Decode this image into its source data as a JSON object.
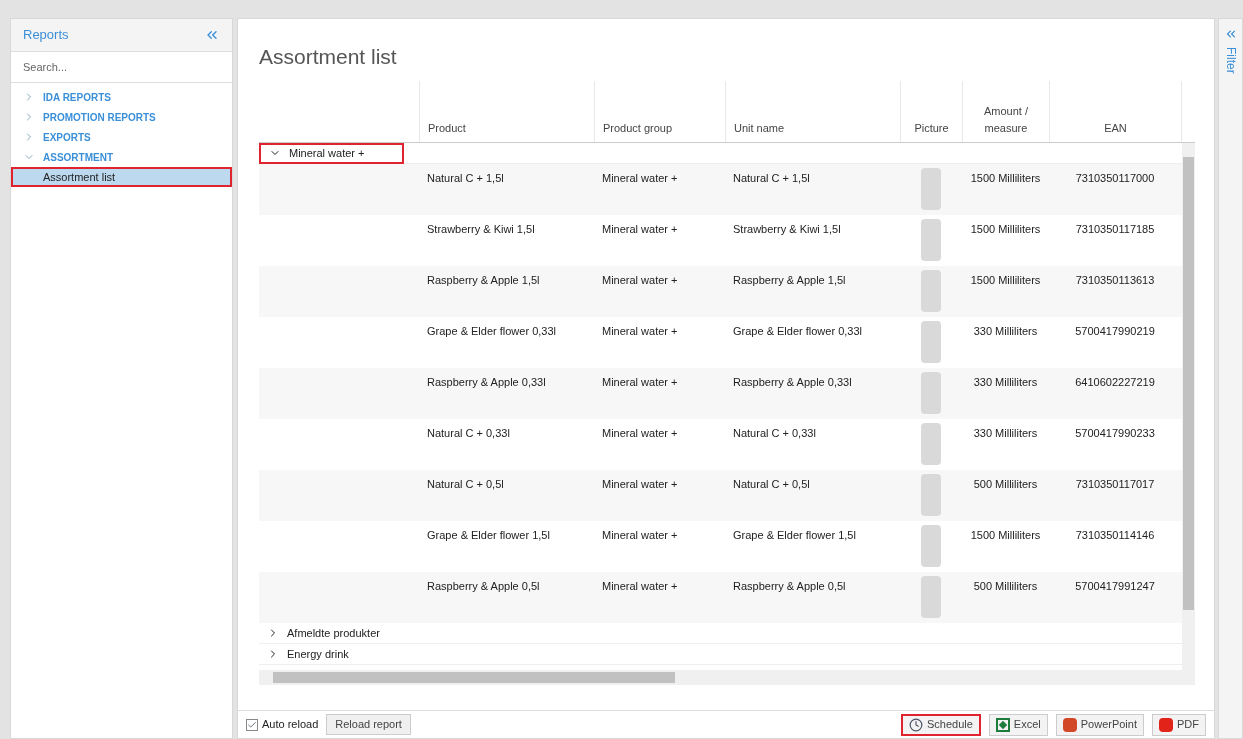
{
  "sidebar": {
    "title": "Reports",
    "search": {
      "placeholder": "Search..."
    },
    "items": [
      {
        "label": "IDA REPORTS",
        "expanded": false
      },
      {
        "label": "PROMOTION REPORTS",
        "expanded": false
      },
      {
        "label": "EXPORTS",
        "expanded": false
      },
      {
        "label": "ASSORTMENT",
        "expanded": true,
        "children": [
          {
            "label": "Assortment list",
            "selected": true,
            "highlighted": true
          }
        ]
      }
    ]
  },
  "filter_panel": {
    "label": "Filter"
  },
  "report": {
    "title": "Assortment list",
    "columns": [
      "Product",
      "Product group",
      "Unit name",
      "Picture",
      "Amount / measure",
      "EAN"
    ],
    "groups": [
      {
        "label": "Mineral water +",
        "expanded": true,
        "highlighted": true,
        "rows": [
          {
            "product": "Natural C + 1,5l",
            "group": "Mineral water +",
            "unit": "Natural C + 1,5l",
            "amount": "1500 Milliliters",
            "ean": "7310350117000"
          },
          {
            "product": "Strawberry & Kiwi 1,5l",
            "group": "Mineral water +",
            "unit": "Strawberry & Kiwi 1,5l",
            "amount": "1500 Milliliters",
            "ean": "7310350117185"
          },
          {
            "product": "Raspberry & Apple 1,5l",
            "group": "Mineral water +",
            "unit": "Raspberry & Apple 1,5l",
            "amount": "1500 Milliliters",
            "ean": "7310350113613"
          },
          {
            "product": "Grape & Elder flower 0,33l",
            "group": "Mineral water +",
            "unit": "Grape & Elder flower 0,33l",
            "amount": "330 Milliliters",
            "ean": "5700417990219"
          },
          {
            "product": "Raspberry & Apple 0,33l",
            "group": "Mineral water +",
            "unit": "Raspberry & Apple 0,33l",
            "amount": "330 Milliliters",
            "ean": "6410602227219"
          },
          {
            "product": "Natural C + 0,33l",
            "group": "Mineral water +",
            "unit": "Natural C + 0,33l",
            "amount": "330 Milliliters",
            "ean": "5700417990233"
          },
          {
            "product": "Natural C + 0,5l",
            "group": "Mineral water +",
            "unit": "Natural C + 0,5l",
            "amount": "500 Milliliters",
            "ean": "7310350117017"
          },
          {
            "product": "Grape & Elder flower 1,5l",
            "group": "Mineral water +",
            "unit": "Grape & Elder flower 1,5l",
            "amount": "1500 Milliliters",
            "ean": "7310350114146"
          },
          {
            "product": "Raspberry & Apple 0,5l",
            "group": "Mineral water +",
            "unit": "Raspberry & Apple 0,5l",
            "amount": "500 Milliliters",
            "ean": "5700417991247"
          }
        ]
      },
      {
        "label": "Afmeldte produkter",
        "expanded": false,
        "highlighted": false
      },
      {
        "label": "Energy drink",
        "expanded": false,
        "highlighted": false
      }
    ]
  },
  "footer": {
    "auto_reload": {
      "label": "Auto reload",
      "checked": true
    },
    "reload_button": "Reload report",
    "exports": [
      {
        "kind": "schedule",
        "label": "Schedule",
        "highlighted": true
      },
      {
        "kind": "excel",
        "label": "Excel",
        "highlighted": false
      },
      {
        "kind": "powerpoint",
        "label": "PowerPoint",
        "highlighted": false
      },
      {
        "kind": "pdf",
        "label": "PDF",
        "highlighted": false
      }
    ]
  }
}
